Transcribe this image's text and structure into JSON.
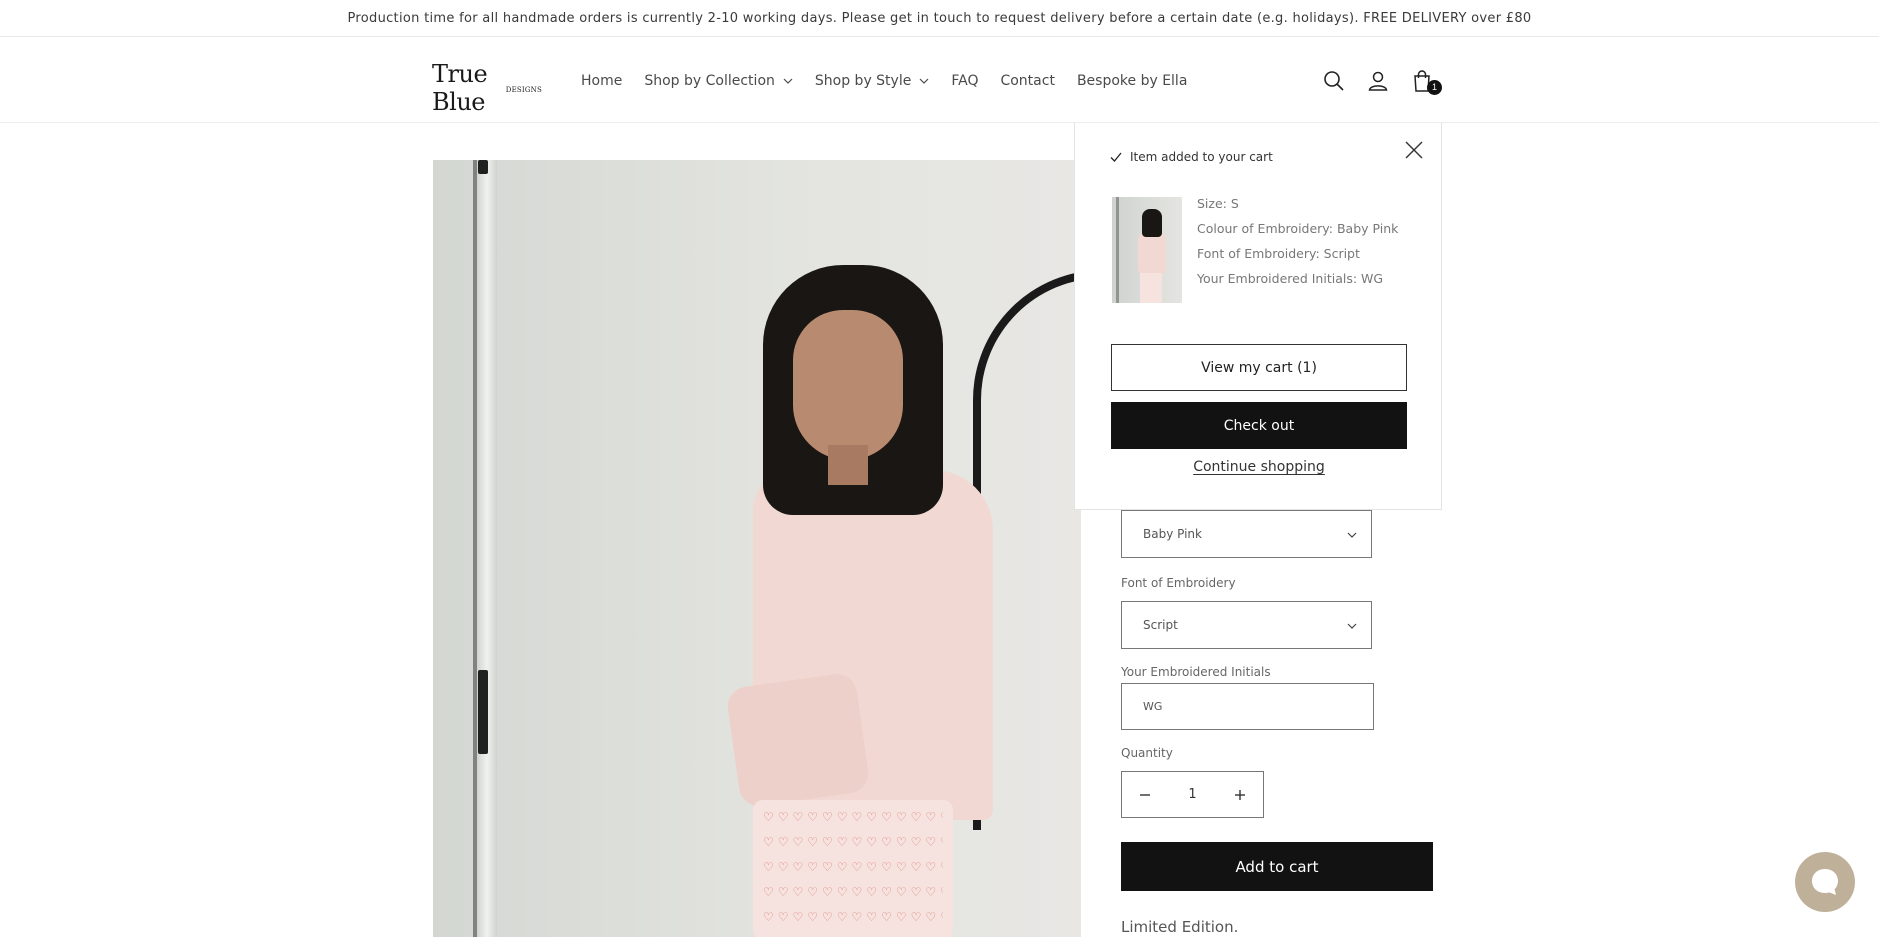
{
  "announcement": "Production time for all handmade orders is currently 2-10 working days. Please get in touch to request delivery before a certain date (e.g. holidays). FREE DELIVERY over £80",
  "header": {
    "logo_main": "True Blue",
    "logo_sub": "DESIGNS",
    "nav": [
      {
        "label": "Home"
      },
      {
        "label": "Shop by Collection"
      },
      {
        "label": "Shop by Style"
      },
      {
        "label": "FAQ"
      },
      {
        "label": "Contact"
      },
      {
        "label": "Bespoke by Ella"
      }
    ],
    "icons": [
      "search-icon",
      "account-icon",
      "cart-icon"
    ],
    "cart_count": "1"
  },
  "cart_popup": {
    "added_text": "Item added to your cart",
    "properties": [
      "Size: S",
      "Colour of Embroidery: Baby Pink",
      "Font of Embroidery: Script",
      "Your Embroidered Initials: WG"
    ],
    "view_cart_label": "View my cart (1)",
    "checkout_label": "Check out",
    "continue_label": "Continue shopping"
  },
  "product_form": {
    "colour_value": "Baby Pink",
    "font_label": "Font of Embroidery",
    "font_value": "Script",
    "initials_label": "Your Embroidered Initials",
    "initials_value": "WG",
    "quantity_label": "Quantity",
    "quantity_value": "1",
    "add_to_cart_label": "Add to cart",
    "limited_text": "Limited Edition."
  },
  "colors": {
    "button_bg": "#121212",
    "chat_bg": "#bfb09a"
  }
}
